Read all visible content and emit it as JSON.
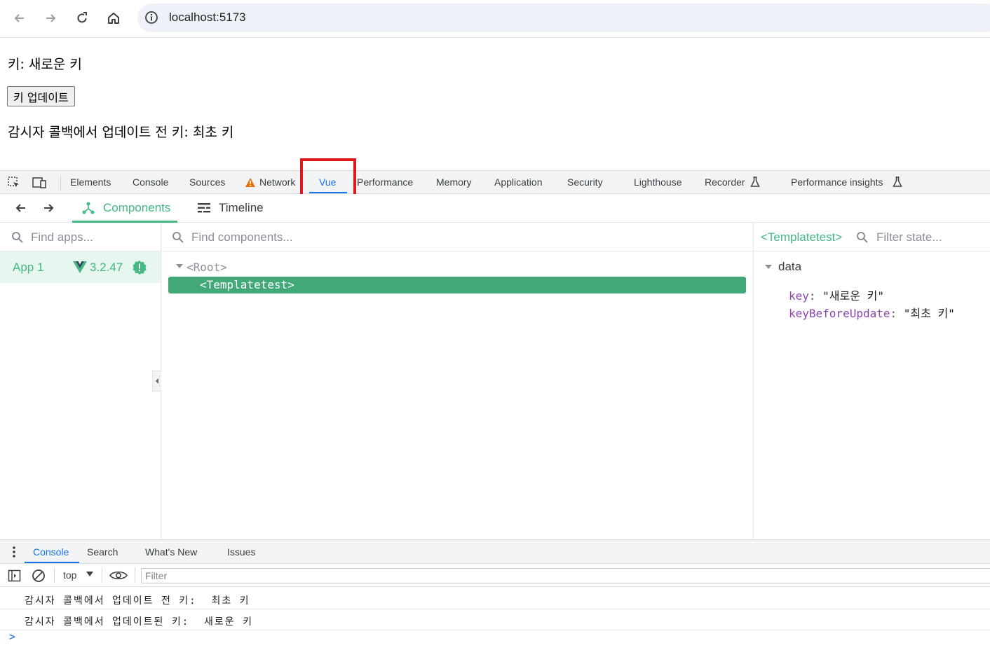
{
  "browser": {
    "url": "localhost:5173"
  },
  "page": {
    "key_line": "키: 새로운 키",
    "update_button": "키 업데이트",
    "watcher_line": "감시자 콜백에서 업데이트 전 키: 최초 키"
  },
  "devtools": {
    "tabs": [
      "Elements",
      "Console",
      "Sources",
      "Network",
      "Vue",
      "Performance",
      "Memory",
      "Application",
      "Security",
      "Lighthouse",
      "Recorder",
      "Performance insights"
    ],
    "active_tab": "Vue"
  },
  "vue": {
    "components_tab": "Components",
    "timeline_tab": "Timeline",
    "find_apps_placeholder": "Find apps...",
    "find_components_placeholder": "Find components...",
    "filter_state_placeholder": "Filter state...",
    "app": {
      "name": "App 1",
      "version": "3.2.47"
    },
    "tree": {
      "root": "<Root>",
      "selected": "<Templatetest>"
    },
    "inspector": {
      "component": "<Templatetest>",
      "section": "data",
      "fields": [
        {
          "key": "key",
          "value": "\"새로운 키\""
        },
        {
          "key": "keyBeforeUpdate",
          "value": "\"최초 키\""
        }
      ]
    }
  },
  "drawer": {
    "tabs": [
      "Console",
      "Search",
      "What's New",
      "Issues"
    ],
    "context": "top",
    "filter_placeholder": "Filter",
    "logs": [
      "감시자 콜백에서 업데이트 전 키:  최초 키",
      "감시자 콜백에서 업데이트된 키:  새로운 키"
    ],
    "prompt": ">"
  },
  "colors": {
    "vue_green": "#42b883",
    "highlight_red": "#e0191f",
    "active_blue": "#1a73e8"
  }
}
